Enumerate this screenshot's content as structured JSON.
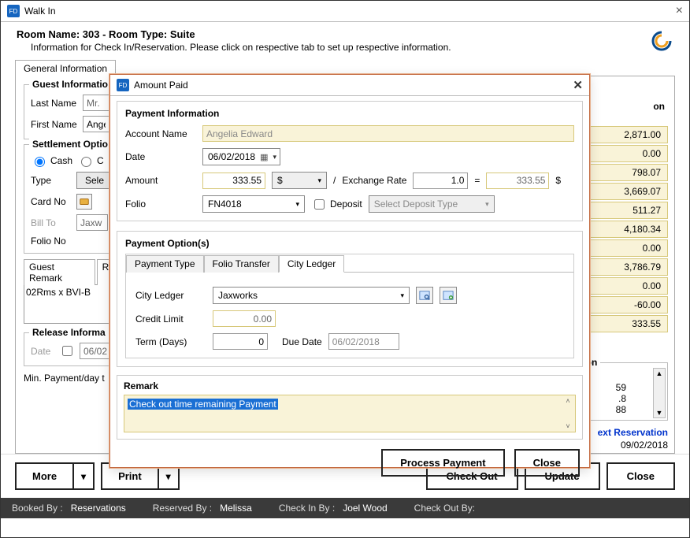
{
  "window": {
    "title": "Walk In",
    "close_x": "×"
  },
  "header": {
    "room_line_prefix": "Room Name: ",
    "room_name": "303",
    "room_line_mid": " - Room Type: ",
    "room_type": "Suite",
    "sub_line": "Information for Check In/Reservation. Please click on respective tab to set up respective information."
  },
  "tabs": {
    "general": "General Information"
  },
  "guest": {
    "section": "Guest Informatio",
    "last_name_lbl": "Last Name",
    "title_value": "Mr.",
    "first_name_lbl": "First Name",
    "first_name_value": "Ange"
  },
  "settlement": {
    "section": "Settlement Optio",
    "cash": "Cash",
    "c2": "C",
    "type_lbl": "Type",
    "select_btn": "Sele",
    "card_no_lbl": "Card No",
    "bill_to_lbl": "Bill To",
    "bill_to_value": "Jaxw",
    "folio_no_lbl": "Folio No"
  },
  "remark": {
    "tab1": "Guest Remark",
    "tab2": "Res",
    "text": "02Rms x BVI-B"
  },
  "release": {
    "section": "Release Informa",
    "date_lbl": "Date",
    "date_value": "06/02",
    "min_pay": "Min. Payment/day t"
  },
  "right": {
    "on": "on",
    "values": [
      "2,871.00",
      "0.00",
      "798.07",
      "3,669.07",
      "511.27",
      "4,180.34",
      "0.00",
      "3,786.79",
      "0.00",
      "-60.00",
      "333.55"
    ],
    "mation": "mation",
    "mation_values": [
      "59",
      ".8",
      "88"
    ],
    "ext_res": "ext Reservation",
    "ext_date": "09/02/2018"
  },
  "buttons": {
    "more": "More",
    "print": "Print",
    "check_out": "Check Out",
    "update": "Update",
    "close": "Close"
  },
  "status": {
    "booked_lbl": "Booked By :",
    "booked_val": "Reservations",
    "reserved_lbl": "Reserved By :",
    "reserved_val": "Melissa",
    "checkin_lbl": "Check In By :",
    "checkin_val": "Joel Wood",
    "checkout_lbl": "Check Out By:"
  },
  "modal": {
    "title": "Amount Paid",
    "section1_title": "Payment Information",
    "account_name_lbl": "Account Name",
    "account_name_value": "Angelia Edward",
    "date_lbl": "Date",
    "date_value": "06/02/2018",
    "amount_lbl": "Amount",
    "amount_value": "333.55",
    "currency": "$",
    "slash": "/",
    "exch_lbl": "Exchange Rate",
    "exch_value": "1.0",
    "equals": "=",
    "amount_conv_value": "333.55",
    "conv_currency": "$",
    "folio_lbl": "Folio",
    "folio_value": "FN4018",
    "deposit_lbl": "Deposit",
    "deposit_select": "Select Deposit Type",
    "section2_title": "Payment Option(s)",
    "po_tabs": {
      "pt": "Payment Type",
      "ft": "Folio Transfer",
      "cl": "City Ledger"
    },
    "city_ledger_lbl": "City Ledger",
    "city_ledger_value": "Jaxworks",
    "credit_limit_lbl": "Credit Limit",
    "credit_limit_value": "0.00",
    "term_lbl": "Term (Days)",
    "term_value": "0",
    "due_date_lbl": "Due Date",
    "due_date_value": "06/02/2018",
    "remark_title": "Remark",
    "remark_text": "Check out time remaining Payment",
    "process_btn": "Process Payment",
    "close_btn": "Close"
  }
}
